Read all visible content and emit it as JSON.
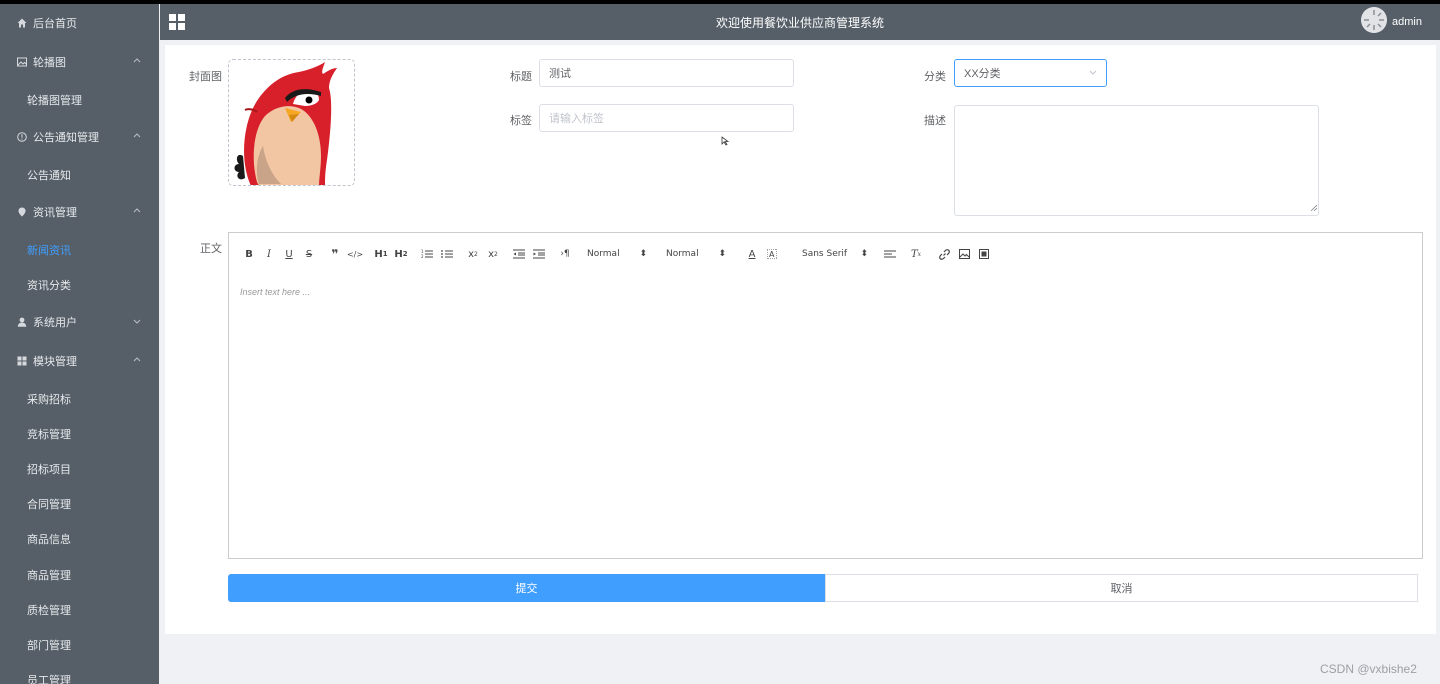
{
  "header": {
    "title": "欢迎使用餐饮业供应商管理系统",
    "username": "admin"
  },
  "sidebar": {
    "items": [
      {
        "label": "后台首页",
        "icon": "home-icon"
      },
      {
        "label": "轮播图",
        "icon": "image-icon",
        "expanded": true
      },
      {
        "label": "轮播图管理",
        "sub": true
      },
      {
        "label": "公告通知管理",
        "icon": "info-icon",
        "expanded": true
      },
      {
        "label": "公告通知",
        "sub": true
      },
      {
        "label": "资讯管理",
        "icon": "location-icon",
        "expanded": true
      },
      {
        "label": "新闻资讯",
        "sub": true,
        "active": true
      },
      {
        "label": "资讯分类",
        "sub": true
      },
      {
        "label": "系统用户",
        "icon": "user-icon",
        "expanded": false
      },
      {
        "label": "模块管理",
        "icon": "grid-icon",
        "expanded": true
      },
      {
        "label": "采购招标",
        "sub": true
      },
      {
        "label": "竞标管理",
        "sub": true
      },
      {
        "label": "招标项目",
        "sub": true
      },
      {
        "label": "合同管理",
        "sub": true
      },
      {
        "label": "商品信息",
        "sub": true
      },
      {
        "label": "商品管理",
        "sub": true
      },
      {
        "label": "质检管理",
        "sub": true
      },
      {
        "label": "部门管理",
        "sub": true
      },
      {
        "label": "员工管理",
        "sub": true
      }
    ]
  },
  "form": {
    "cover_label": "封面图",
    "title_label": "标题",
    "title_value": "测试",
    "tags_label": "标签",
    "tags_placeholder": "请输入标签",
    "category_label": "分类",
    "category_value": "XX分类",
    "desc_label": "描述",
    "body_label": "正文",
    "editor_placeholder": "Insert text here ...",
    "toolbar": {
      "header_select": "Normal",
      "size_select": "Normal",
      "font_select": "Sans Serif"
    },
    "submit_label": "提交",
    "cancel_label": "取消"
  },
  "colors": {
    "sidebar_bg": "#565f68",
    "accent": "#409eff"
  },
  "watermark": "CSDN @vxbishe2"
}
